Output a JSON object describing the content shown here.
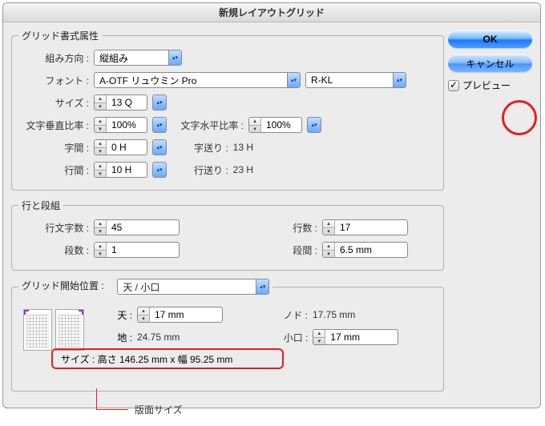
{
  "title": "新規レイアウトグリッド",
  "buttons": {
    "ok": "OK",
    "cancel": "キャンセル",
    "preview": "プレビュー"
  },
  "fs1": {
    "legend": "グリッド書式属性",
    "dir_label": "組み方向 :",
    "dir_value": "縦組み",
    "font_label": "フォント :",
    "font_value": "A-OTF リュウミン Pro",
    "font_style": "R-KL",
    "size_label": "サイズ :",
    "size_value": "13 Q",
    "vscale_label": "文字垂直比率 :",
    "vscale_value": "100%",
    "hscale_label": "文字水平比率 :",
    "hscale_value": "100%",
    "aki_label": "字間 :",
    "aki_value": "0 H",
    "jiokuri_label": "字送り :",
    "jiokuri_value": "13 H",
    "gyokan_label": "行間 :",
    "gyokan_value": "10 H",
    "gyookuri_label": "行送り :",
    "gyookuri_value": "23 H"
  },
  "fs2": {
    "legend": "行と段組",
    "chars_label": "行文字数 :",
    "chars_value": "45",
    "lines_label": "行数 :",
    "lines_value": "17",
    "cols_label": "段数 :",
    "cols_value": "1",
    "gutter_label": "段間 :",
    "gutter_value": "6.5 mm"
  },
  "fs3": {
    "legend": "グリッド開始位置 :",
    "start_value": "天 / 小口",
    "ten_label": "天 :",
    "ten_value": "17 mm",
    "chi_label": "地 :",
    "chi_value": "24.75 mm",
    "nodo_label": "ノド :",
    "nodo_value": "17.75 mm",
    "koguchi_label": "小口 :",
    "koguchi_value": "17 mm"
  },
  "size_ann": "サイズ : 高さ 146.25 mm x 幅 95.25 mm",
  "ann_label": "版面サイズ"
}
